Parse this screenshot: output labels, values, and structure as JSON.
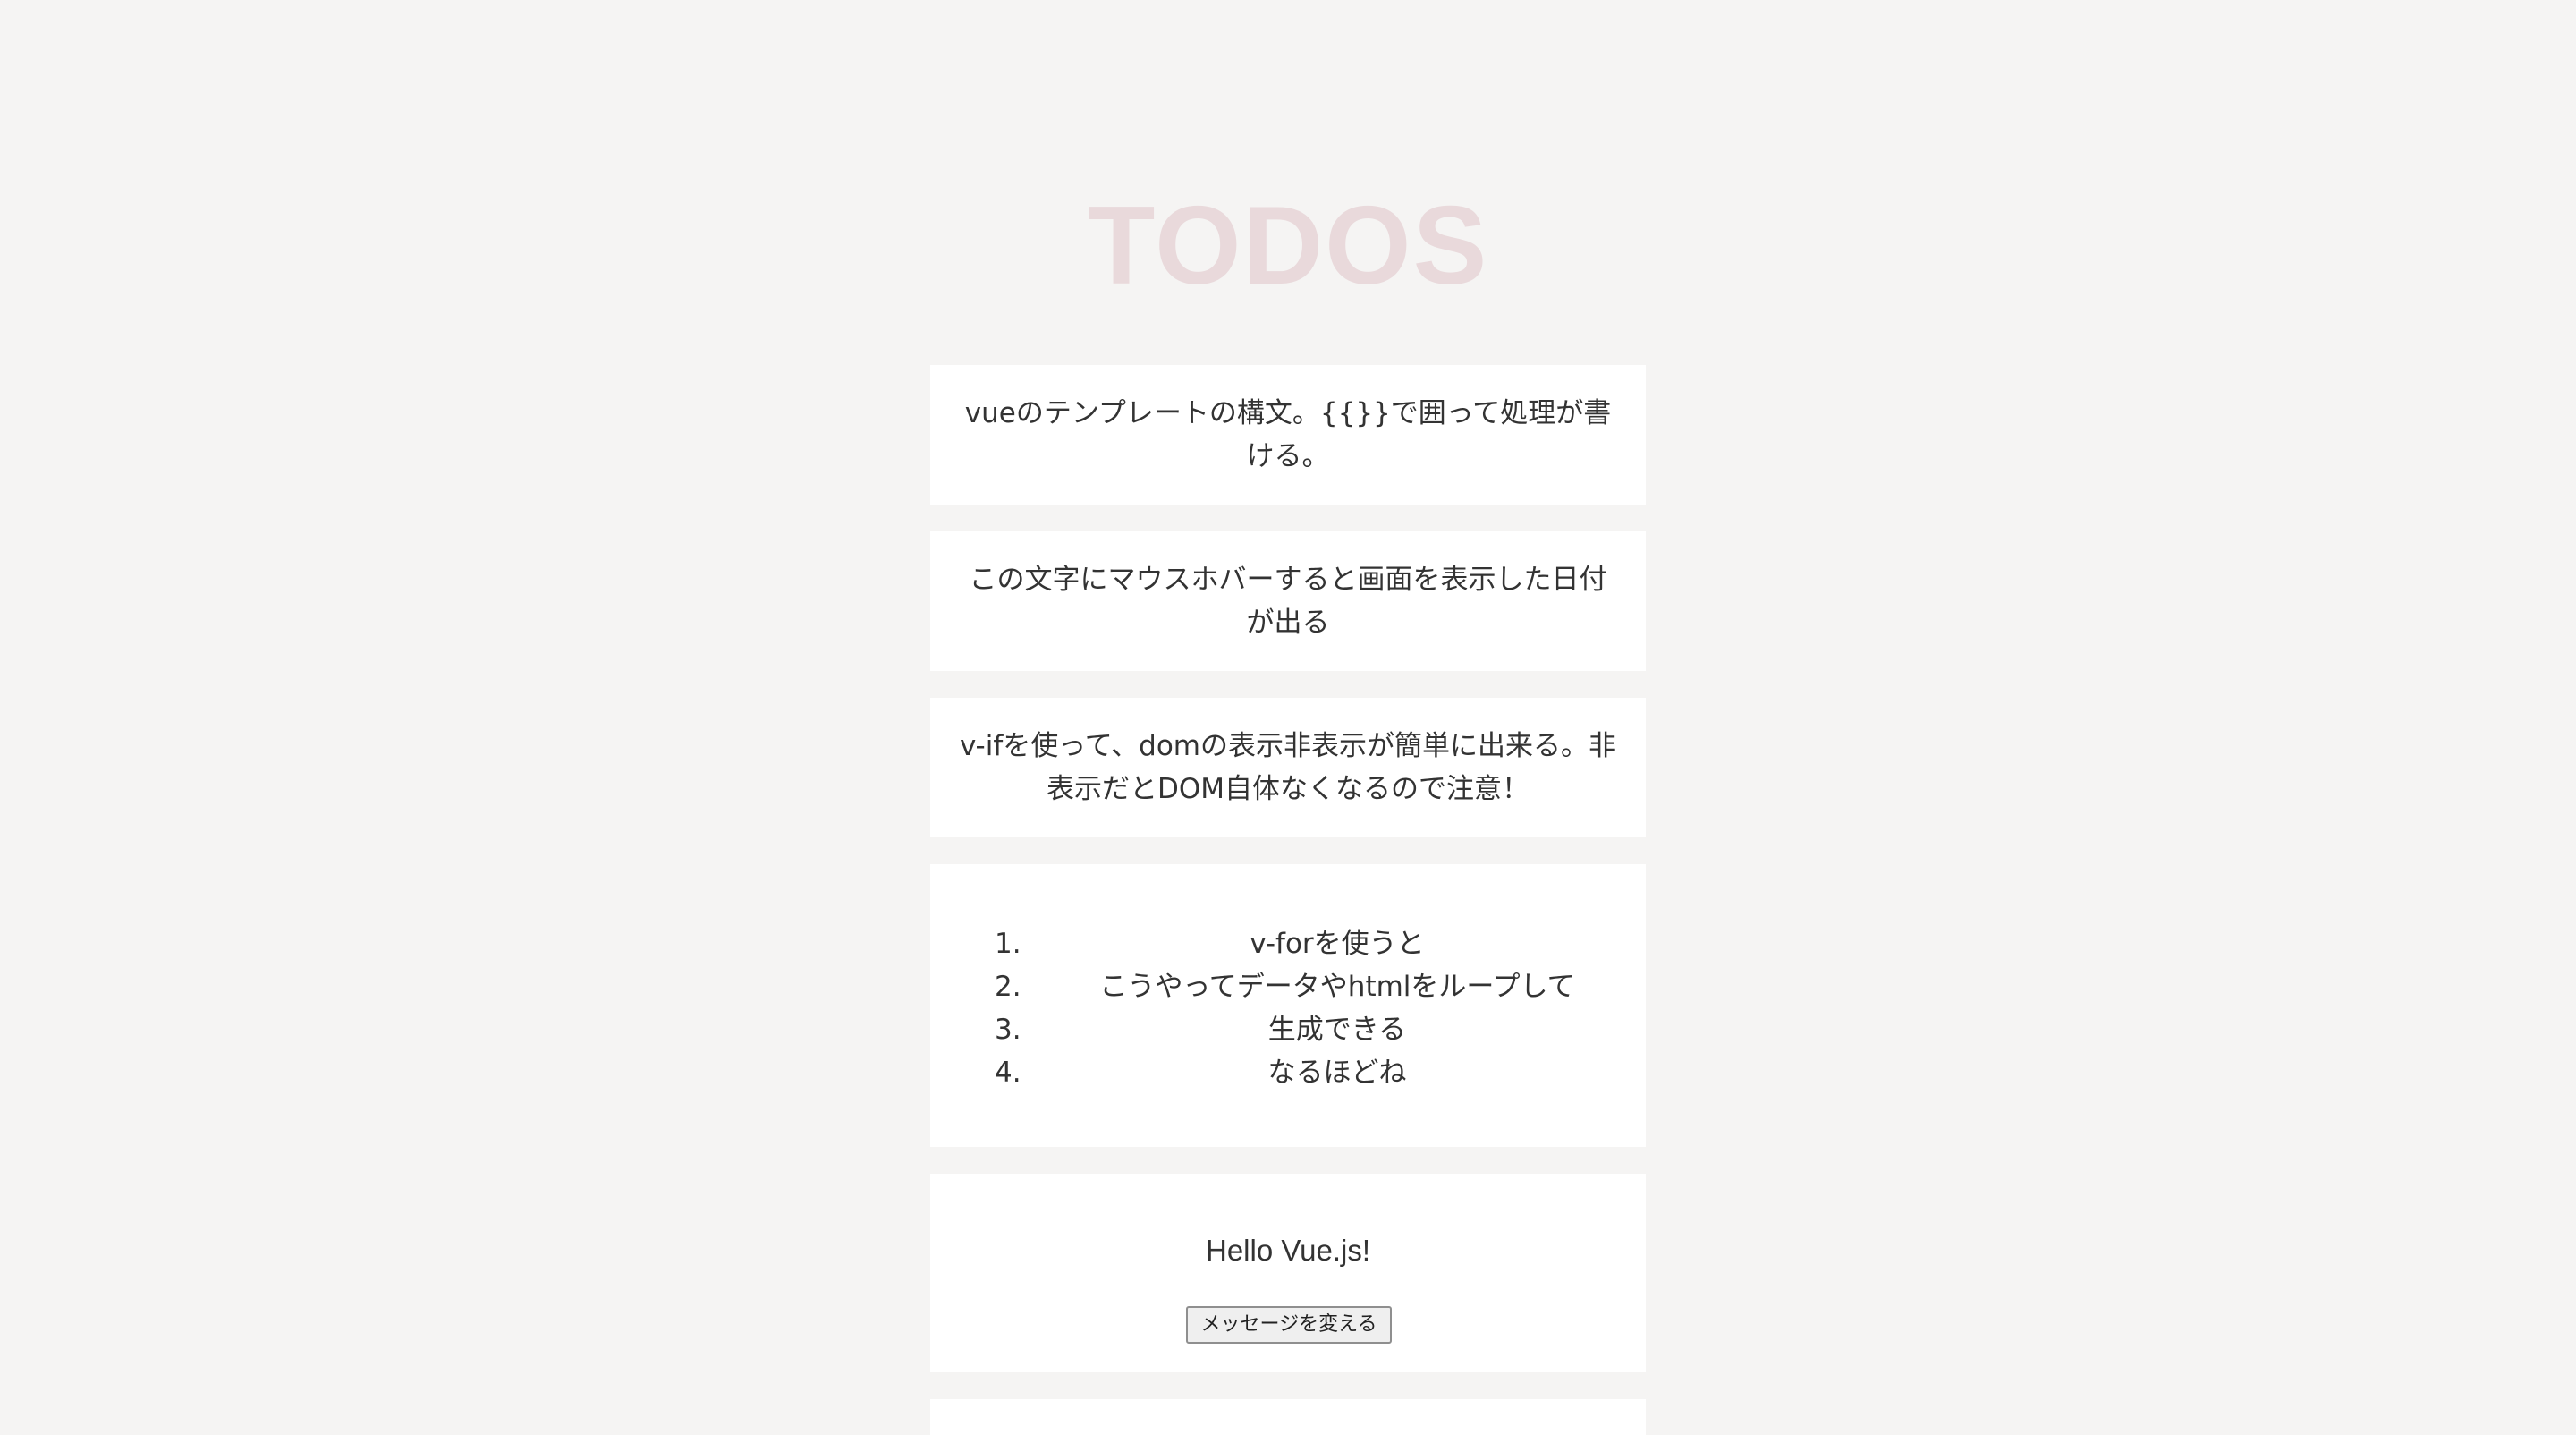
{
  "page": {
    "title": "TODOS"
  },
  "cards": [
    {
      "text": "vueのテンプレートの構文。{{}}で囲って処理が書ける。"
    },
    {
      "text": "この文字にマウスホバーすると画面を表示した日付が出る"
    },
    {
      "text": "v-ifを使って、domの表示非表示が簡単に出来る。非表示だとDOM自体なくなるので注意！"
    }
  ],
  "todo_list": {
    "items": [
      {
        "number": "1.",
        "text": "v-forを使うと"
      },
      {
        "number": "2.",
        "text": "こうやってデータやhtmlをループして"
      },
      {
        "number": "3.",
        "text": "生成できる"
      },
      {
        "number": "4.",
        "text": "なるほどね"
      }
    ]
  },
  "message_card": {
    "message": "Hello Vue.js!",
    "button_label": "メッセージを変える"
  },
  "colors": {
    "background": "#f5f4f3",
    "card": "#ffffff",
    "title": "#e9d9db",
    "text": "#333333"
  }
}
